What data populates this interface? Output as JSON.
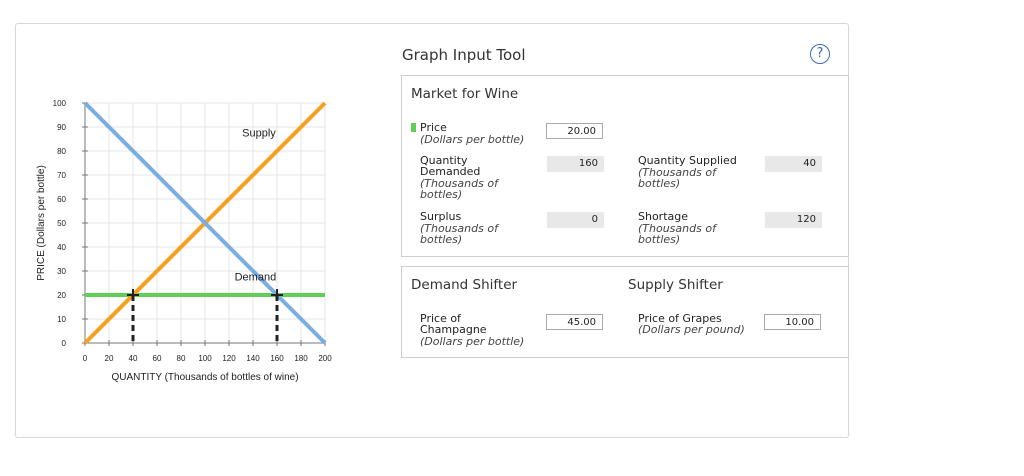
{
  "chart_data": {
    "type": "line",
    "xlabel": "QUANTITY (Thousands of bottles of wine)",
    "ylabel": "PRICE (Dollars per bottle)",
    "xlim": [
      0,
      200
    ],
    "ylim": [
      0,
      100
    ],
    "x_ticks": [
      0,
      20,
      40,
      60,
      80,
      100,
      120,
      140,
      160,
      180,
      200
    ],
    "y_ticks": [
      0,
      10,
      20,
      30,
      40,
      50,
      60,
      70,
      80,
      90,
      100
    ],
    "grid": true,
    "series": [
      {
        "name": "Supply",
        "x": [
          0,
          200
        ],
        "y": [
          0,
          100
        ],
        "color": "#f5a020"
      },
      {
        "name": "Demand",
        "x": [
          0,
          200
        ],
        "y": [
          100,
          0
        ],
        "color": "#7aaee0"
      }
    ],
    "price_line": {
      "y": 20,
      "x": [
        0,
        200
      ],
      "color": "#5fcf57"
    },
    "vertical_markers": [
      {
        "x": 40,
        "y": 20
      },
      {
        "x": 160,
        "y": 20
      }
    ],
    "annotations": [
      {
        "text": "Supply",
        "x": 145,
        "y": 86
      },
      {
        "text": "Demand",
        "x": 142,
        "y": 26
      }
    ]
  },
  "tool": {
    "title": "Graph Input Tool",
    "help_icon": "?",
    "market": {
      "title": "Market for Wine",
      "price_label": "Price",
      "price_sub": "(Dollars per bottle)",
      "price_value": "20.00",
      "qd_label_1": "Quantity",
      "qd_label_2": "Demanded",
      "qd_sub_1": "(Thousands of",
      "qd_sub_2": "bottles)",
      "qd_value": "160",
      "qs_label": "Quantity Supplied",
      "qs_sub_1": "(Thousands of",
      "qs_sub_2": "bottles)",
      "qs_value": "40",
      "surplus_label": "Surplus",
      "surplus_sub_1": "(Thousands of",
      "surplus_sub_2": "bottles)",
      "surplus_value": "0",
      "shortage_label": "Shortage",
      "shortage_sub_1": "(Thousands of",
      "shortage_sub_2": "bottles)",
      "shortage_value": "120"
    },
    "shifters": {
      "demand_title": "Demand Shifter",
      "supply_title": "Supply Shifter",
      "champagne_label_1": "Price of",
      "champagne_label_2": "Champagne",
      "champagne_sub": "(Dollars per bottle)",
      "champagne_value": "45.00",
      "grapes_label": "Price of Grapes",
      "grapes_sub": "(Dollars per pound)",
      "grapes_value": "10.00"
    }
  }
}
